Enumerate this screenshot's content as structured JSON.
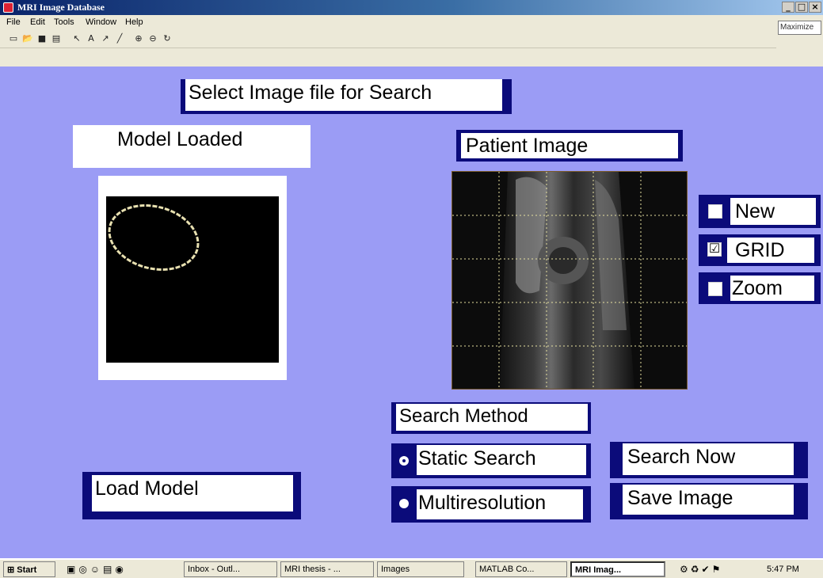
{
  "window": {
    "title": "MRI Image Database",
    "controls": [
      "_",
      "□",
      "×"
    ]
  },
  "menubar": {
    "items": [
      "File",
      "Edit",
      "Tools",
      "Window",
      "Help"
    ],
    "maximize_hint": "Maximize"
  },
  "toolbar": {
    "icons": [
      "new-file-icon",
      "open-folder-icon",
      "save-icon",
      "print-icon",
      "pointer-icon",
      "text-icon",
      "arrow-icon",
      "line-icon",
      "zoom-in-icon",
      "zoom-out-icon",
      "rotate-icon"
    ]
  },
  "figure": {
    "select_image_label": "Select Image file for Search",
    "model_loaded_label": "Model Loaded",
    "patient_image_label": "Patient Image",
    "checkboxes": [
      {
        "label": "New",
        "checked": false
      },
      {
        "label": "GRID",
        "checked": true
      },
      {
        "label": "Zoom",
        "checked": false
      }
    ],
    "search_method_label": "Search Method",
    "radios": [
      {
        "label": "Static  Search",
        "selected": true
      },
      {
        "label": "Multiresolution",
        "selected": false
      }
    ],
    "buttons": {
      "load_model": "Load Model",
      "search_now": "Search Now",
      "save_image": "Save Image"
    },
    "grid": {
      "rows": 5,
      "cols": 5
    }
  },
  "taskbar": {
    "start": "Start",
    "tasks": [
      {
        "label": "Inbox - Outl...",
        "active": false
      },
      {
        "label": "MRI thesis - ...",
        "active": false
      },
      {
        "label": "Images",
        "active": false
      },
      {
        "label": "MATLAB Co...",
        "active": false
      },
      {
        "label": "MRI Imag...",
        "active": true
      }
    ],
    "clock": "5:47 PM"
  },
  "colors": {
    "canvas": "#9b9cf5",
    "navy": "#0b0b7a",
    "title_start": "#0a246a"
  }
}
